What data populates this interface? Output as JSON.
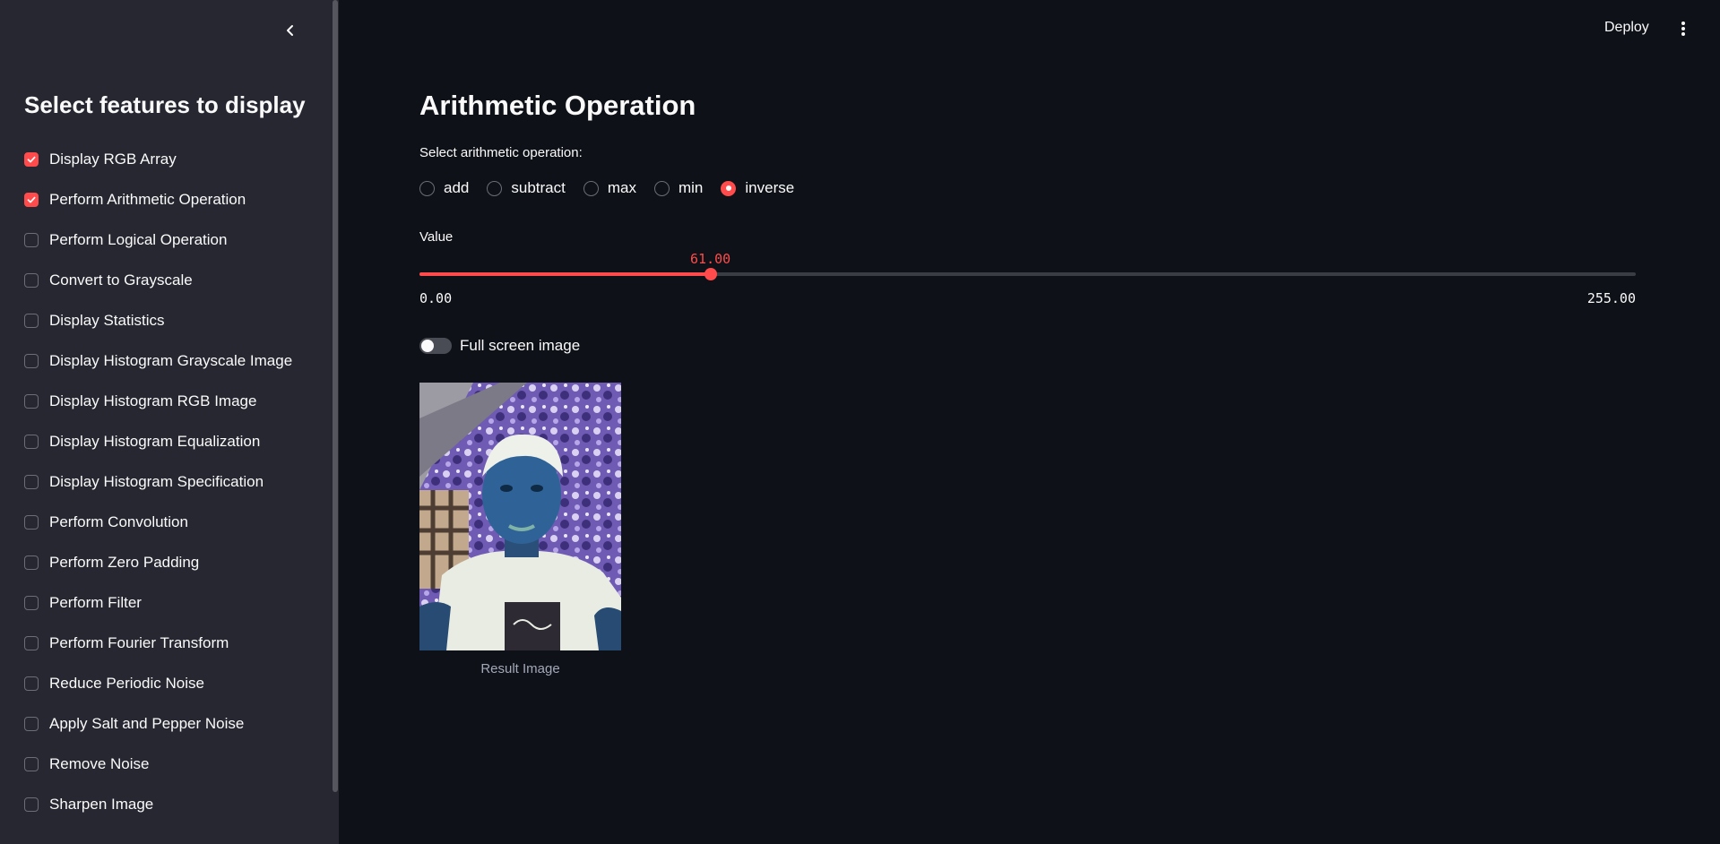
{
  "sidebar": {
    "title": "Select features to display",
    "collapse_icon": "chevron-left-icon",
    "features": [
      {
        "label": "Display RGB Array",
        "checked": true
      },
      {
        "label": "Perform Arithmetic Operation",
        "checked": true
      },
      {
        "label": "Perform Logical Operation",
        "checked": false
      },
      {
        "label": "Convert to Grayscale",
        "checked": false
      },
      {
        "label": "Display Statistics",
        "checked": false
      },
      {
        "label": "Display Histogram Grayscale Image",
        "checked": false
      },
      {
        "label": "Display Histogram RGB Image",
        "checked": false
      },
      {
        "label": "Display Histogram Equalization",
        "checked": false
      },
      {
        "label": "Display Histogram Specification",
        "checked": false
      },
      {
        "label": "Perform Convolution",
        "checked": false
      },
      {
        "label": "Perform Zero Padding",
        "checked": false
      },
      {
        "label": "Perform Filter",
        "checked": false
      },
      {
        "label": "Perform Fourier Transform",
        "checked": false
      },
      {
        "label": "Reduce Periodic Noise",
        "checked": false
      },
      {
        "label": "Apply Salt and Pepper Noise",
        "checked": false
      },
      {
        "label": "Remove Noise",
        "checked": false
      },
      {
        "label": "Sharpen Image",
        "checked": false
      }
    ]
  },
  "header": {
    "deploy_label": "Deploy",
    "menu_icon": "more-vertical-icon"
  },
  "main": {
    "title": "Arithmetic Operation",
    "operation": {
      "label": "Select arithmetic operation:",
      "options": [
        "add",
        "subtract",
        "max",
        "min",
        "inverse"
      ],
      "selected": "inverse"
    },
    "slider": {
      "label": "Value",
      "value": 61.0,
      "value_text": "61.00",
      "min": 0,
      "max": 255,
      "min_text": "0.00",
      "max_text": "255.00"
    },
    "fullscreen_toggle": {
      "label": "Full screen image",
      "on": false
    },
    "result": {
      "caption": "Result Image"
    }
  },
  "colors": {
    "accent": "#ff4b4b",
    "background": "#0e1117",
    "sidebar": "#262730",
    "text": "#fafafa"
  }
}
